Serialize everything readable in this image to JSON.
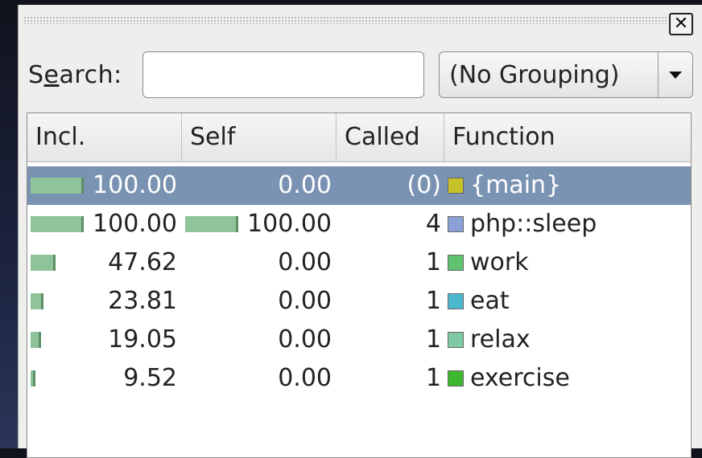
{
  "dock": {
    "close_glyph": "✕"
  },
  "search": {
    "label_pre": "S",
    "label_underline": "e",
    "label_post": "arch:",
    "value": "",
    "placeholder": ""
  },
  "grouping": {
    "selected": "(No Grouping)"
  },
  "columns": [
    "Incl.",
    "Self",
    "Called",
    "Function"
  ],
  "rows": [
    {
      "incl": "100.00",
      "incl_fraction": 1.0,
      "self": "0.00",
      "self_fraction": 0.0,
      "called": "(0)",
      "function": "{main}",
      "color": "#c8c22a",
      "selected": true
    },
    {
      "incl": "100.00",
      "incl_fraction": 1.0,
      "self": "100.00",
      "self_fraction": 1.0,
      "called": "4",
      "function": "php::sleep",
      "color": "#8aa0d6",
      "selected": false
    },
    {
      "incl": "47.62",
      "incl_fraction": 0.4762,
      "self": "0.00",
      "self_fraction": 0.0,
      "called": "1",
      "function": "work",
      "color": "#5fc26e",
      "selected": false
    },
    {
      "incl": "23.81",
      "incl_fraction": 0.2381,
      "self": "0.00",
      "self_fraction": 0.0,
      "called": "1",
      "function": "eat",
      "color": "#4cb8cf",
      "selected": false
    },
    {
      "incl": "19.05",
      "incl_fraction": 0.1905,
      "self": "0.00",
      "self_fraction": 0.0,
      "called": "1",
      "function": "relax",
      "color": "#7fc9a6",
      "selected": false
    },
    {
      "incl": "9.52",
      "incl_fraction": 0.0952,
      "self": "0.00",
      "self_fraction": 0.0,
      "called": "1",
      "function": "exercise",
      "color": "#3cb82e",
      "selected": false
    }
  ]
}
